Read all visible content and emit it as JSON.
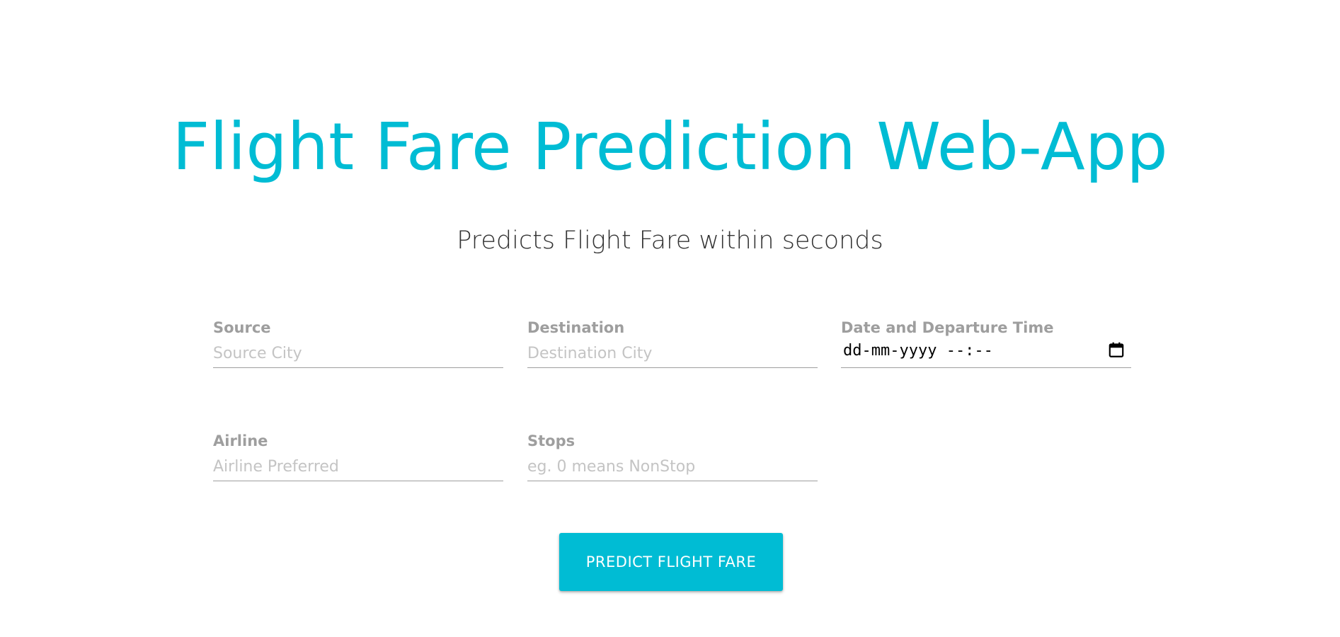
{
  "header": {
    "title": "Flight Fare Prediction Web-App",
    "subtitle": "Predicts Flight Fare within seconds"
  },
  "colors": {
    "accent": "#00bcd4",
    "subtitle_text": "#333333",
    "label_text": "#9e9e9e",
    "placeholder_text": "#c4c4c4"
  },
  "form": {
    "source": {
      "label": "Source",
      "placeholder": "Source City",
      "value": ""
    },
    "destination": {
      "label": "Destination",
      "placeholder": "Destination City",
      "value": ""
    },
    "departure": {
      "label": "Date and Departure Time",
      "display_value": "dd-mm-yyyy --:--",
      "icon": "calendar-icon"
    },
    "airline": {
      "label": "Airline",
      "placeholder": "Airline Preferred",
      "value": ""
    },
    "stops": {
      "label": "Stops",
      "placeholder": "eg. 0 means NonStop",
      "value": ""
    },
    "submit_label": "PREDICT FLIGHT FARE"
  }
}
